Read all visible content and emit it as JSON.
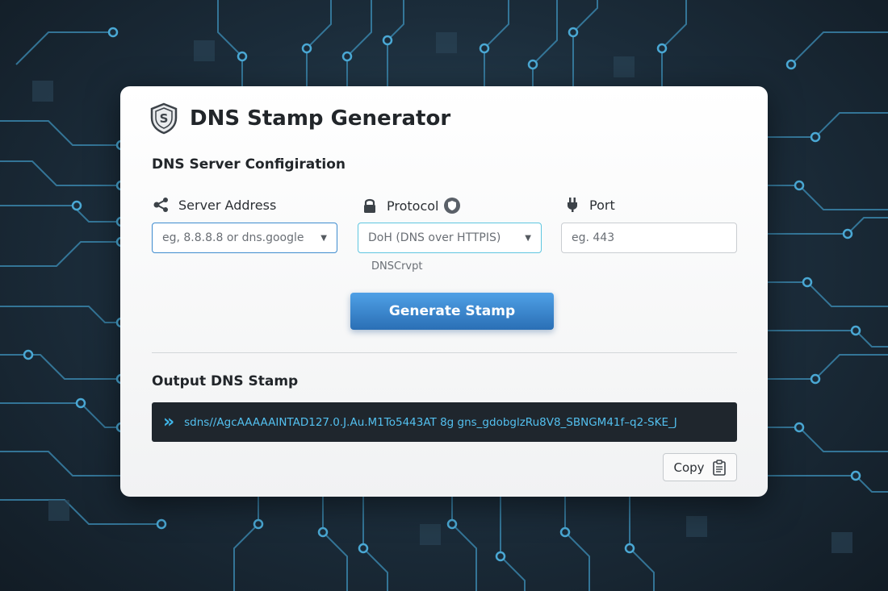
{
  "app": {
    "title": "DNS Stamp Generator",
    "logo_icon": "shield-s-icon"
  },
  "config": {
    "section_title": "DNS Server Configiration",
    "server_address": {
      "label": "Server Address",
      "icon": "network-nodes-icon",
      "placeholder": "eg, 8.8.8.8  or  dns.google"
    },
    "protocol": {
      "label": "Protocol",
      "icon": "lock-icon",
      "info_icon": "shield-info-icon",
      "selected": "DoH (DNS over HTTPIS)",
      "other_option": "DNSCrvpt"
    },
    "port": {
      "label": "Port",
      "icon": "plug-icon",
      "placeholder": "eg. 443"
    },
    "generate_label": "Generate Stamp"
  },
  "output": {
    "section_title": "Output DNS Stamp",
    "stamp": "sdns//AgcAAAAAINTAD127.0.J.Au.M1To5443AT  8g  gns_gdobglzRu8V8_SBNGM41f–q2-SKE_J",
    "copy_label": "Copy",
    "copy_icon": "clipboard-icon"
  },
  "colors": {
    "accent": "#2a6fb5",
    "accent_light": "#4fa0e6",
    "stamp_text": "#53c0ef",
    "output_bg": "#1f262d",
    "background": "#1b2c3a"
  }
}
